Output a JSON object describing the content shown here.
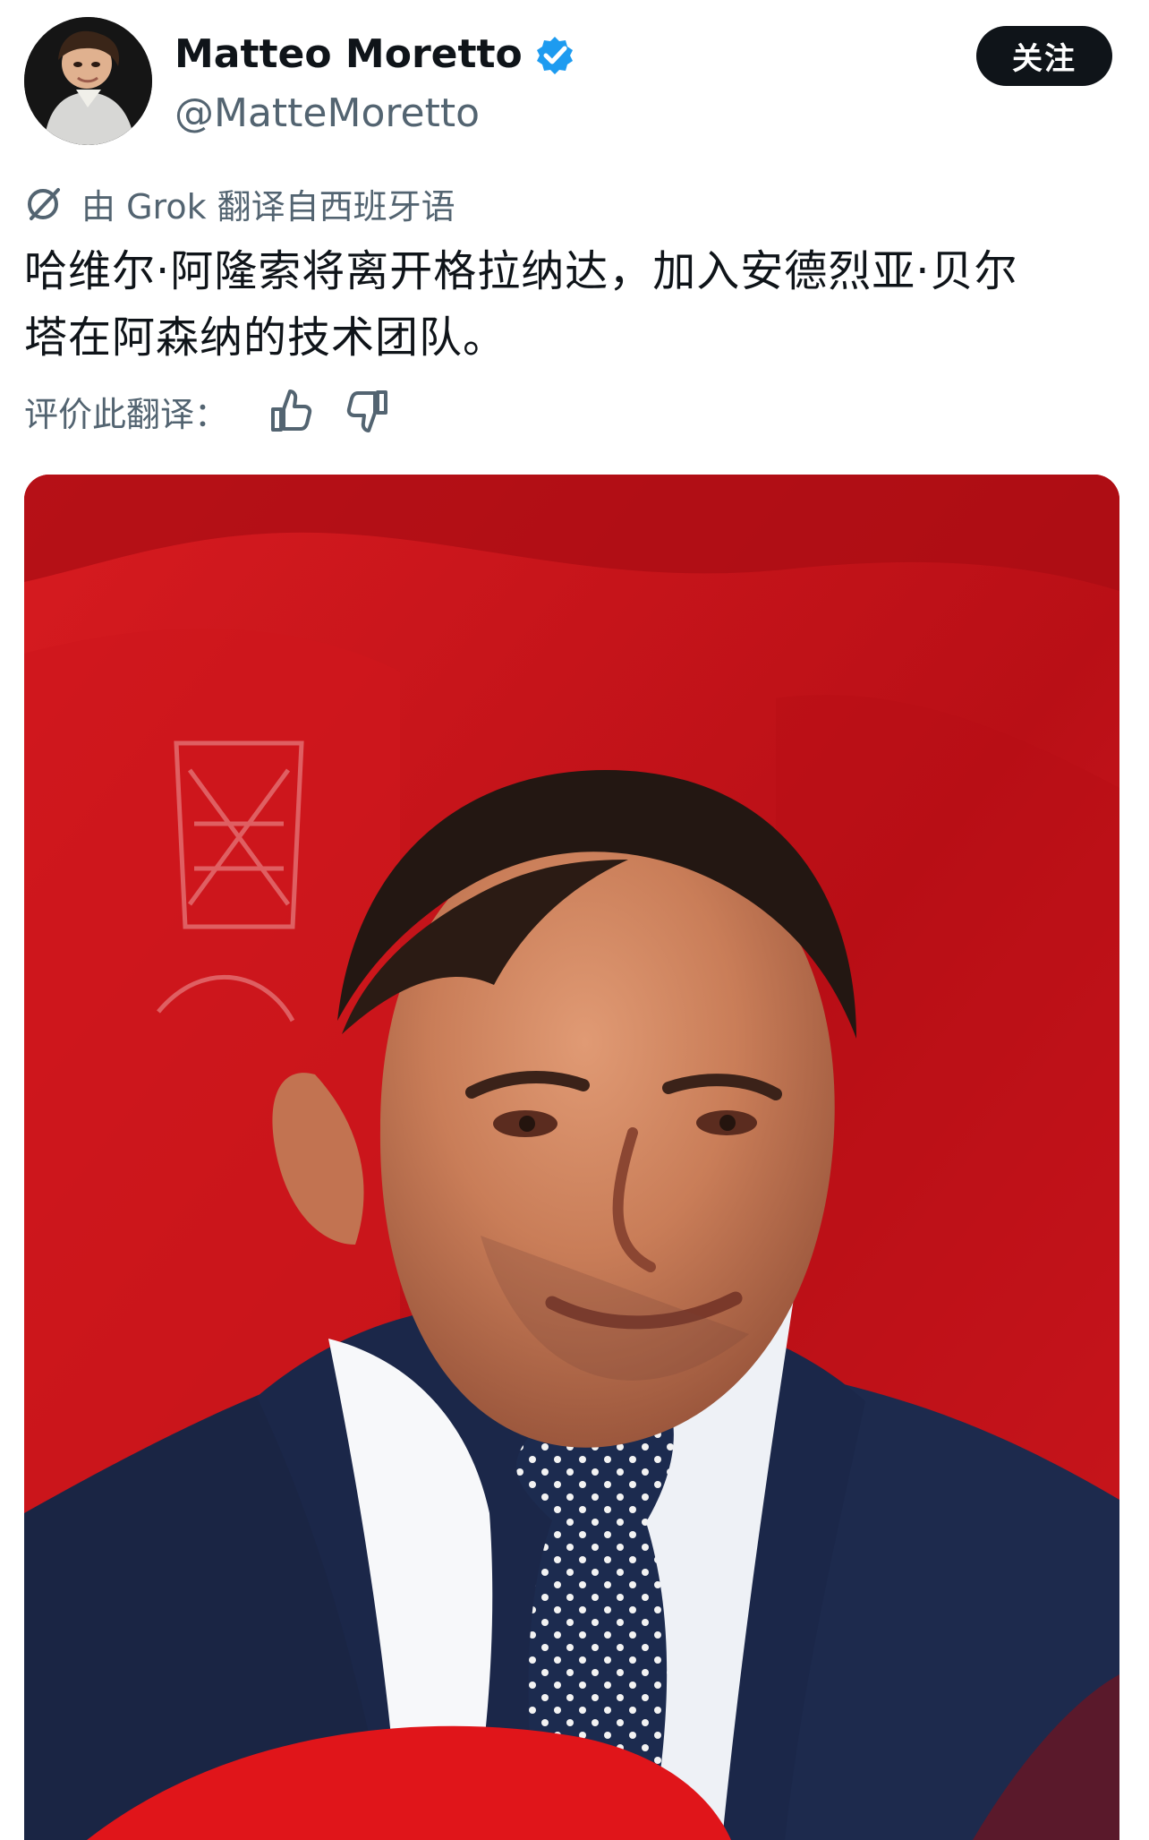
{
  "post": {
    "author": {
      "display_name": "Matteo Moretto",
      "handle": "@MatteMoretto",
      "verified_icon": "verified-badge-icon",
      "avatar": "profile-avatar"
    },
    "follow_label": "关注",
    "translation_note": "由 Grok 翻译自西班牙语",
    "text_lines": [
      "哈维尔·阿隆索将离开格拉纳达，加入安德烈亚·贝尔",
      "塔在阿森纳的技术团队。"
    ],
    "rating": {
      "label": "评价此翻译："
    },
    "image": {
      "subject": "man in navy suit and polka-dot tie seated in red stadium bench",
      "icon": "photo"
    }
  },
  "colors": {
    "primary_text": "#0f1419",
    "secondary_text": "#536471",
    "verified_blue": "#1d9bf0",
    "button_background": "#0f1419",
    "photo_red": "#c91619"
  },
  "icons": {
    "translation": "grok-translation-icon",
    "like": "thumbs-up-icon",
    "dislike": "thumbs-down-icon"
  }
}
